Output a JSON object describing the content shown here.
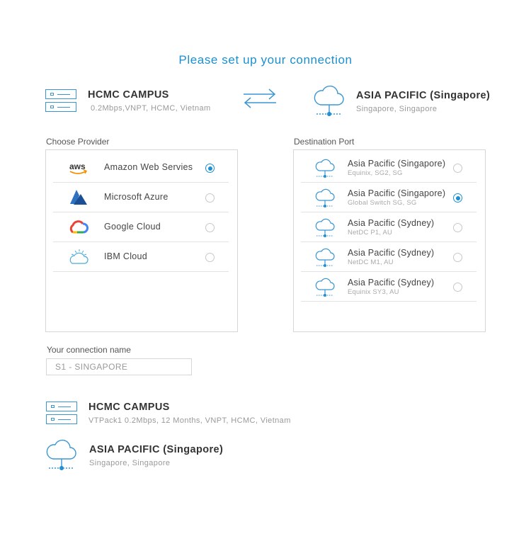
{
  "title": "Please set up your connection",
  "source": {
    "name": "HCMC CAMPUS",
    "detail": "0.2Mbps,VNPT, HCMC, Vietnam"
  },
  "destination": {
    "name": "ASIA PACIFIC (Singapore)",
    "detail": "Singapore, Singapore"
  },
  "provider_section": {
    "label": "Choose Provider",
    "items": [
      {
        "label": "Amazon Web Servies",
        "icon": "aws-logo-icon",
        "selected": true
      },
      {
        "label": "Microsoft Azure",
        "icon": "azure-logo-icon",
        "selected": false
      },
      {
        "label": "Google Cloud",
        "icon": "google-cloud-logo-icon",
        "selected": false
      },
      {
        "label": "IBM Cloud",
        "icon": "ibm-cloud-logo-icon",
        "selected": false
      }
    ]
  },
  "port_section": {
    "label": "Destination Port",
    "items": [
      {
        "title": "Asia Pacific (Singapore)",
        "detail": "Equinix, SG2, SG",
        "selected": false
      },
      {
        "title": "Asia Pacific (Singapore)",
        "detail": "Global Switch SG, SG",
        "selected": true
      },
      {
        "title": "Asia Pacific (Sydney)",
        "detail": "NetDC P1, AU",
        "selected": false
      },
      {
        "title": "Asia Pacific (Sydney)",
        "detail": "NetDC M1, AU",
        "selected": false
      },
      {
        "title": "Asia Pacific (Sydney)",
        "detail": "Equinix SY3, AU",
        "selected": false
      }
    ]
  },
  "connection_name": {
    "label": "Your connection name",
    "value": "S1 - SINGAPORE"
  },
  "summary": {
    "source_name": "HCMC CAMPUS",
    "source_detail": "VTPack1 0.2Mbps, 12 Months, VNPT, HCMC, Vietnam",
    "dest_name": "ASIA PACIFIC (Singapore)",
    "dest_detail": "Singapore, Singapore"
  },
  "colors": {
    "accent": "#1a8fd1",
    "icon_blue": "#3a96d3"
  }
}
